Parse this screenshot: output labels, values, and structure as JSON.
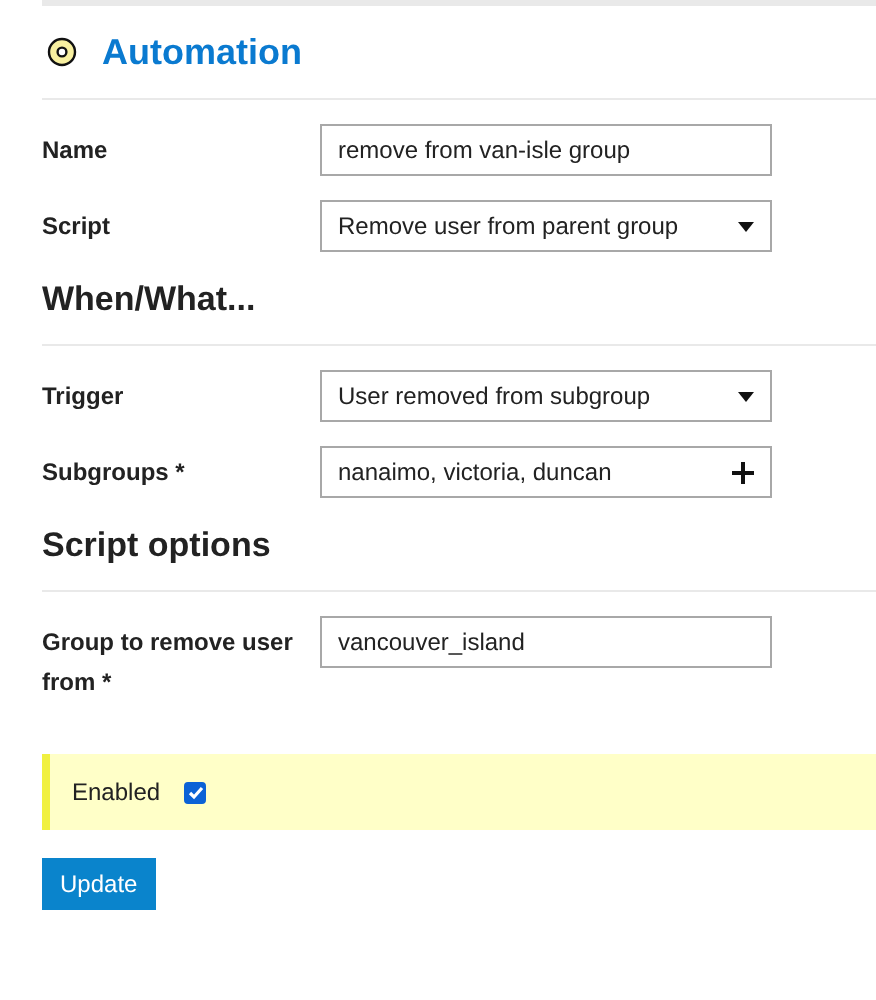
{
  "title": "Automation",
  "fields": [
    {
      "label": "Name",
      "kind": "text",
      "value": "remove from van-isle group"
    },
    {
      "label": "Script",
      "kind": "select",
      "value": "Remove user from parent group"
    }
  ],
  "sections": [
    {
      "heading": "When/What...",
      "fields": [
        {
          "label": "Trigger",
          "kind": "select",
          "value": "User removed from subgroup"
        },
        {
          "label": "Subgroups *",
          "kind": "multi",
          "value": "nanaimo, victoria, duncan"
        }
      ]
    },
    {
      "heading": "Script options",
      "fields": [
        {
          "label": "Group to remove user from *",
          "kind": "text",
          "value": "vancouver_island"
        }
      ]
    }
  ],
  "enabled": {
    "label": "Enabled",
    "checked": true
  },
  "button": "Update"
}
